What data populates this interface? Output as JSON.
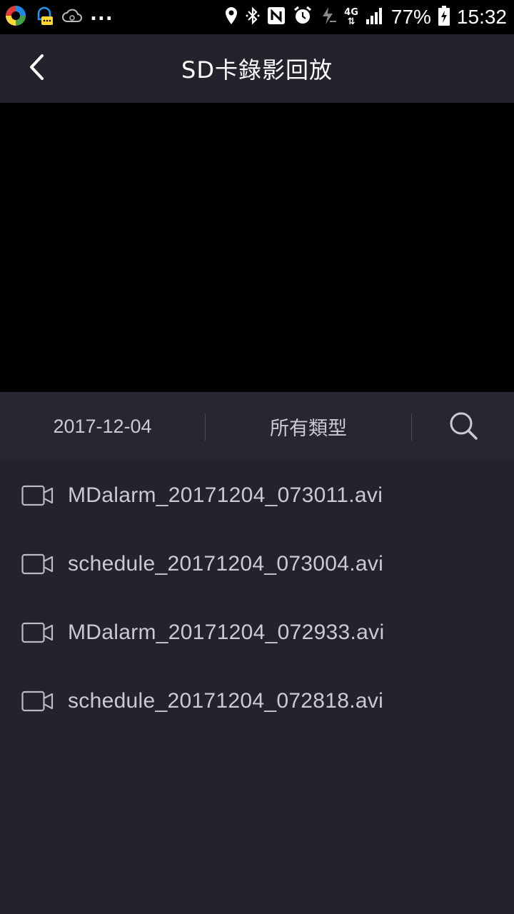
{
  "status_bar": {
    "battery": "77%",
    "time": "15:32",
    "network": "4G",
    "more_indicator": "...",
    "icons": [
      "app-circle-icon",
      "bell-chat-icon",
      "cloud-icon",
      "location-icon",
      "bluetooth-icon",
      "nfc-icon",
      "alarm-icon",
      "flash-icon",
      "signal-icon",
      "battery-icon"
    ]
  },
  "header": {
    "title": "SD卡錄影回放",
    "back_icon": "chevron-left-icon"
  },
  "filter": {
    "date": "2017-12-04",
    "type": "所有類型",
    "search_icon": "search-icon"
  },
  "recordings": [
    {
      "name": "MDalarm_20171204_073011.avi"
    },
    {
      "name": "schedule_20171204_073004.avi"
    },
    {
      "name": "MDalarm_20171204_072933.avi"
    },
    {
      "name": "schedule_20171204_072818.avi"
    }
  ],
  "colors": {
    "background": "#22232d",
    "filter_bar": "#262732",
    "text": "#c9cbd2",
    "title": "#ffffff",
    "player": "#000000"
  }
}
